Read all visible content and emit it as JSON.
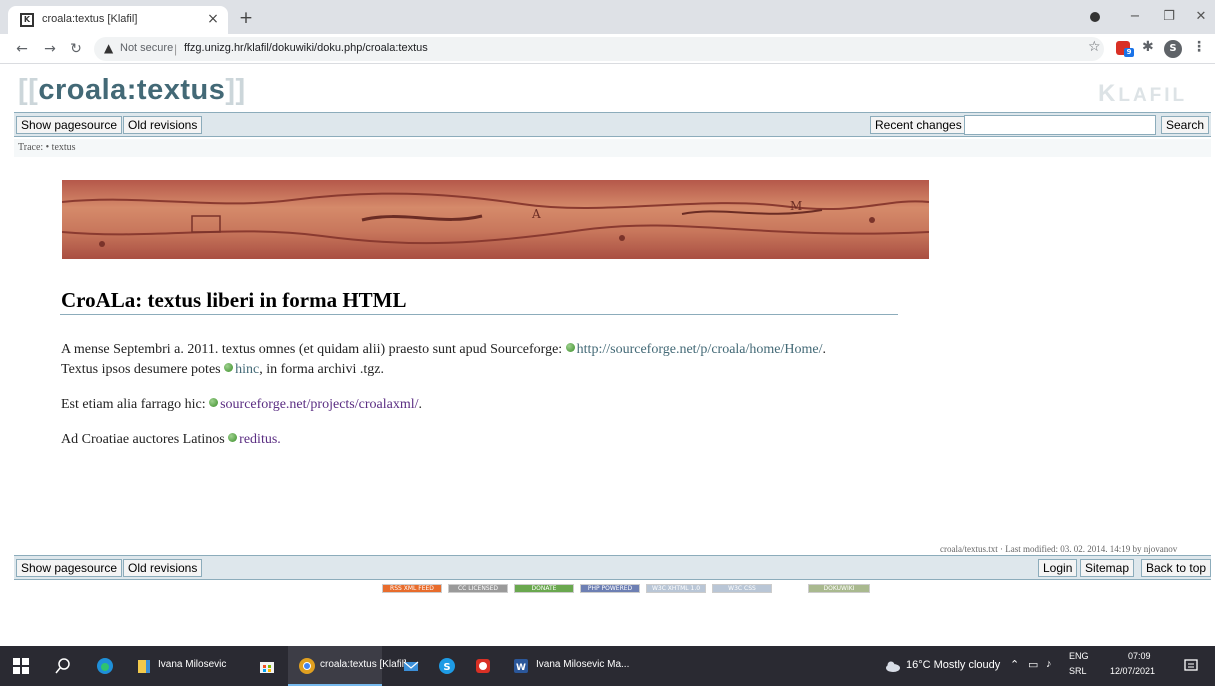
{
  "browser": {
    "tab_title": "croala:textus [Klafil]",
    "new_tab_icon": "+",
    "close_icon": "×",
    "not_secure": "Not secure",
    "url": "ffzg.unizg.hr/klafil/dokuwiki/doku.php/croala:textus",
    "ext_badge": "9",
    "avatar_letter": "S"
  },
  "wiki": {
    "title": "croala:textus",
    "logo_first": "K",
    "logo_rest": "LAFIL",
    "toolbar": {
      "show_pagesource": "Show pagesource",
      "old_revisions": "Old revisions",
      "recent_changes": "Recent changes",
      "search": "Search"
    },
    "trace": "Trace: • textus",
    "heading": "CroALa: textus liberi in forma HTML",
    "p1_text_a": "A mense Septembri a. 2011. textus omnes (et quidam alii) praesto sunt apud Sourceforge: ",
    "p1_link": "http://sourceforge.net/p/croala/home/Home/",
    "p1_text_b": ".",
    "p2_text_a": "Textus ipsos desumere potes ",
    "p2_link": "hinc",
    "p2_text_b": ", in forma archivi .tgz.",
    "p3_text_a": "Est etiam alia farrago hic: ",
    "p3_link": "sourceforge.net/projects/croalaxml/",
    "p3_text_b": ".",
    "p4_text_a": "Ad Croatiae auctores Latinos ",
    "p4_link": "reditus",
    "p4_text_b": ".",
    "last_modified": "croala/textus.txt · Last modified: 03. 02. 2014. 14:19 by njovanov",
    "footer": {
      "show_pagesource": "Show pagesource",
      "old_revisions": "Old revisions",
      "login": "Login",
      "sitemap": "Sitemap",
      "back_to_top": "Back to top"
    },
    "badges": [
      "RSS XML FEED",
      "CC LICENSED",
      "DONATE",
      "PHP POWERED",
      "W3C XHTML 1.0",
      "W3C CSS",
      "DOKUWIKI"
    ]
  },
  "taskbar": {
    "item1": "Ivana Milosevic",
    "item2": "croala:textus [Klafil]...",
    "item3": "Ivana Milosevic Ma...",
    "weather": "16°C Mostly cloudy",
    "lang_top": "ENG",
    "lang_bottom": "SRL",
    "time": "07:09",
    "date": "12/07/2021"
  },
  "colors": {
    "wiki_accent": "#436976",
    "bar_bg": "#dee7ec",
    "bar_border": "#8cacbb",
    "taskbar_bg": "#2a2a32"
  }
}
